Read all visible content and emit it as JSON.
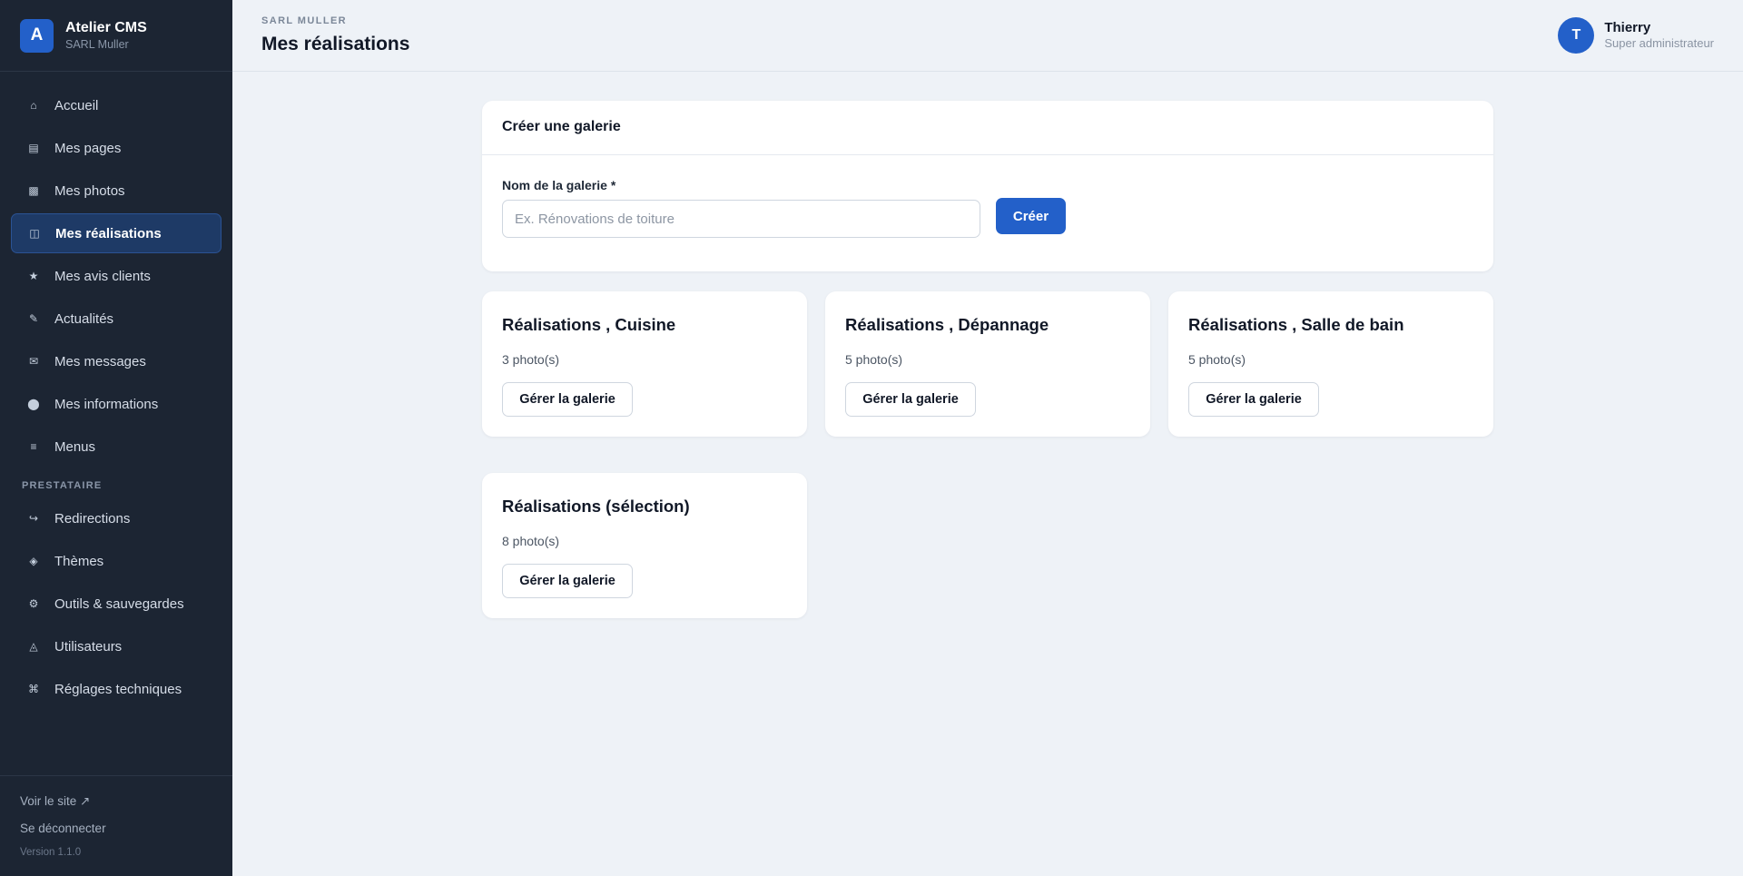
{
  "brand": {
    "logo_letter": "A",
    "name": "Atelier CMS",
    "subtitle": "SARL Muller"
  },
  "sidebar": {
    "items": [
      {
        "label": "Accueil",
        "icon": "home-icon",
        "glyph": "⌂"
      },
      {
        "label": "Mes pages",
        "icon": "pages-icon",
        "glyph": "▤"
      },
      {
        "label": "Mes photos",
        "icon": "photos-icon",
        "glyph": "▩"
      },
      {
        "label": "Mes réalisations",
        "icon": "gallery-icon",
        "glyph": "◫",
        "active": true
      },
      {
        "label": "Mes avis clients",
        "icon": "star-icon",
        "glyph": "★"
      },
      {
        "label": "Actualités",
        "icon": "pencil-icon",
        "glyph": "✎"
      },
      {
        "label": "Mes messages",
        "icon": "mail-icon",
        "glyph": "✉"
      },
      {
        "label": "Mes informations",
        "icon": "info-icon",
        "glyph": "⬤"
      },
      {
        "label": "Menus",
        "icon": "menu-icon",
        "glyph": "≡"
      }
    ],
    "section_label": "PRESTATAIRE",
    "provider_items": [
      {
        "label": "Redirections",
        "icon": "redirect-icon",
        "glyph": "↪"
      },
      {
        "label": "Thèmes",
        "icon": "theme-icon",
        "glyph": "◈"
      },
      {
        "label": "Outils & sauvegardes",
        "icon": "tools-icon",
        "glyph": "⚙"
      },
      {
        "label": "Utilisateurs",
        "icon": "users-icon",
        "glyph": "◬"
      },
      {
        "label": "Réglages techniques",
        "icon": "command-icon",
        "glyph": "⌘"
      }
    ],
    "footer": {
      "view_site": "Voir le site ↗",
      "logout": "Se déconnecter",
      "version": "Version 1.1.0"
    }
  },
  "header": {
    "breadcrumb": "SARL MULLER",
    "title": "Mes réalisations"
  },
  "user": {
    "initial": "T",
    "name": "Thierry",
    "role": "Super administrateur"
  },
  "create_gallery": {
    "title": "Créer une galerie",
    "field_label": "Nom de la galerie *",
    "placeholder": "Ex. Rénovations de toiture",
    "value": "",
    "button": "Créer"
  },
  "galleries": [
    {
      "title": "Réalisations , Cuisine",
      "count": "3 photo(s)",
      "button": "Gérer la galerie"
    },
    {
      "title": "Réalisations , Dépannage",
      "count": "5 photo(s)",
      "button": "Gérer la galerie"
    },
    {
      "title": "Réalisations , Salle de bain",
      "count": "5 photo(s)",
      "button": "Gérer la galerie"
    },
    {
      "title": "Réalisations (sélection)",
      "count": "8 photo(s)",
      "button": "Gérer la galerie"
    }
  ],
  "colors": {
    "accent": "#2360c9",
    "sidebar_bg": "#1c2533",
    "page_bg": "#eef2f7"
  }
}
